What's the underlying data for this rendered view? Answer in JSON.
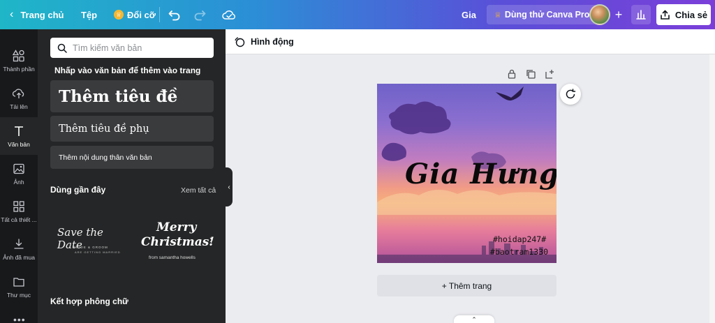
{
  "topbar": {
    "home_label": "Trang chủ",
    "file_label": "Tệp",
    "resize_label": "Đổi cỡ",
    "design_title": "Gia",
    "try_pro_label": "Dùng thử Canva Pro",
    "share_label": "Chia sẻ"
  },
  "rail": {
    "items": [
      {
        "label": "Thành phần",
        "icon": "elements-icon"
      },
      {
        "label": "Tải lên",
        "icon": "upload-icon"
      },
      {
        "label": "Văn bản",
        "icon": "text-icon"
      },
      {
        "label": "Ảnh",
        "icon": "photo-icon"
      },
      {
        "label": "Tất cả thiết ...",
        "icon": "apps-icon"
      },
      {
        "label": "Ảnh đã mua",
        "icon": "download-icon"
      },
      {
        "label": "Thư mục",
        "icon": "folder-icon"
      }
    ],
    "active": "Văn bản"
  },
  "panel": {
    "search_placeholder": "Tìm kiếm văn bản",
    "hint": "Nhấp vào văn bản để thêm vào trang",
    "heading_button": "Thêm tiêu đề",
    "subheading_button": "Thêm tiêu đề phụ",
    "body_button": "Thêm nội dung thân văn bản",
    "recent_title": "Dùng gần đây",
    "see_all": "Xem tất cả",
    "templates": [
      {
        "line1": "Save the Date",
        "line2": "BRIDE & GROOM",
        "line3": "ARE GETTING MARRIED"
      },
      {
        "line1": "Merry",
        "line2": "Christmas!",
        "line3": "from samantha howells"
      }
    ],
    "font_combos_title": "Kết hợp phông chữ"
  },
  "toolbar": {
    "animate_label": "Hình động"
  },
  "canvas": {
    "title": "Gia Hưng",
    "tag1": "#hoidap247#",
    "tag2": "#baotram1330"
  },
  "workspace": {
    "add_page_label": "+ Thêm trang"
  },
  "colors": {
    "accent_gradient_start": "#1fb6c8",
    "accent_gradient_end": "#7b3fd9",
    "sidebar": "#18191b",
    "panel": "#252627",
    "pro_crown": "#f5b731"
  }
}
